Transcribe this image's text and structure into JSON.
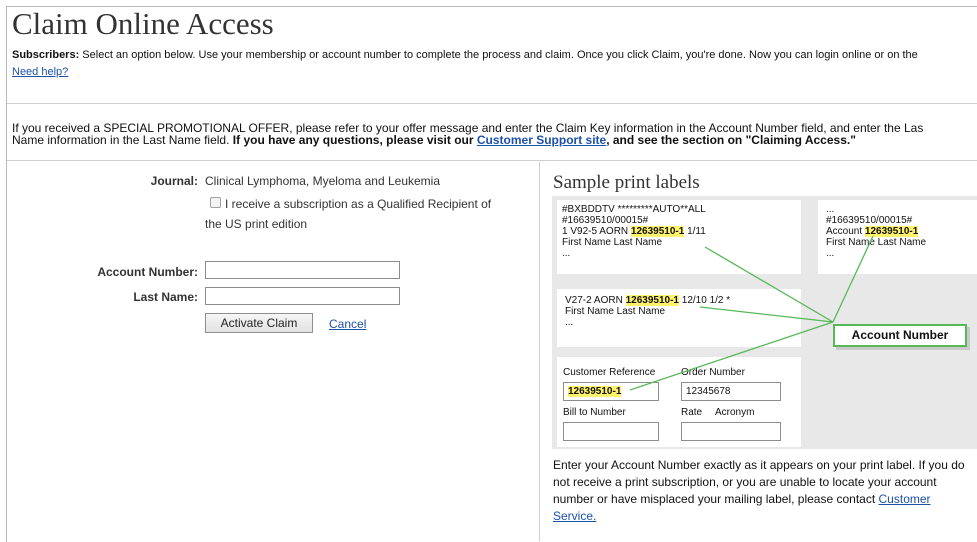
{
  "header": {
    "title": "Claim Online Access",
    "subscribers_label": "Subscribers:",
    "subscribers_text": " Select an option below. Use your membership or account number to complete the process and claim. Once you click Claim, you're done. Now you can login online or on the",
    "need_help": "Need help?"
  },
  "promo": {
    "line1": "If you received a SPECIAL PROMOTIONAL OFFER, please refer to your offer message and enter the Claim Key information in the Account Number field, and enter the Las",
    "line2_plain": "Name information in the Last Name field. ",
    "line2_bold": "If you have any questions, please visit our ",
    "link": "Customer Support site",
    "line2_tail": ", and see the section on \"Claiming Access.\""
  },
  "form": {
    "journal_label": "Journal:",
    "journal_value": "Clinical Lymphoma, Myeloma and Leukemia",
    "checkbox_line1": "I receive a subscription as a Qualified Recipient of",
    "checkbox_line2": "the US print edition",
    "account_label": "Account Number:",
    "account_value": "",
    "lastname_label": "Last Name:",
    "lastname_value": "",
    "activate_button": "Activate Claim",
    "cancel_link": "Cancel"
  },
  "sample": {
    "title": "Sample print labels",
    "card1": {
      "line1": "#BXBDDTV  *********AUTO**ALL",
      "line2": "#16639510/00015#",
      "line3_pre": "1 V92-5 AORN ",
      "line3_hl": "12639510-1",
      "line3_post": " 1/11",
      "line4": "First Name Last Name",
      "line5": "..."
    },
    "card2": {
      "line0": "...",
      "line1": "#16639510/00015#",
      "line2_pre": "Account ",
      "line2_hl": "12639510-1",
      "line3": "First Name Last Name",
      "line4": "..."
    },
    "card3": {
      "line1_pre": "V27-2 AORN ",
      "line1_hl": "12639510-1",
      "line1_post": " 12/10 1/2 *",
      "line2": "First Name Last Name",
      "line3": "..."
    },
    "card4": {
      "customer_reference_label": "Customer Reference",
      "customer_reference_value": "12639510-1",
      "order_number_label": "Order Number",
      "order_number_value": "12345678",
      "bill_to_label": "Bill to Number",
      "rate_label": "Rate",
      "acronym_label": "Acronym"
    },
    "callout": "Account Number",
    "accent": "#57b857",
    "highlight": "#fff36b"
  },
  "bottom": {
    "text": "Enter your Account Number exactly as it appears on your print label. If you do not receive a print subscription, or you are unable to locate your account number or have misplaced your mailing label, please contact ",
    "link": "Customer Service."
  }
}
